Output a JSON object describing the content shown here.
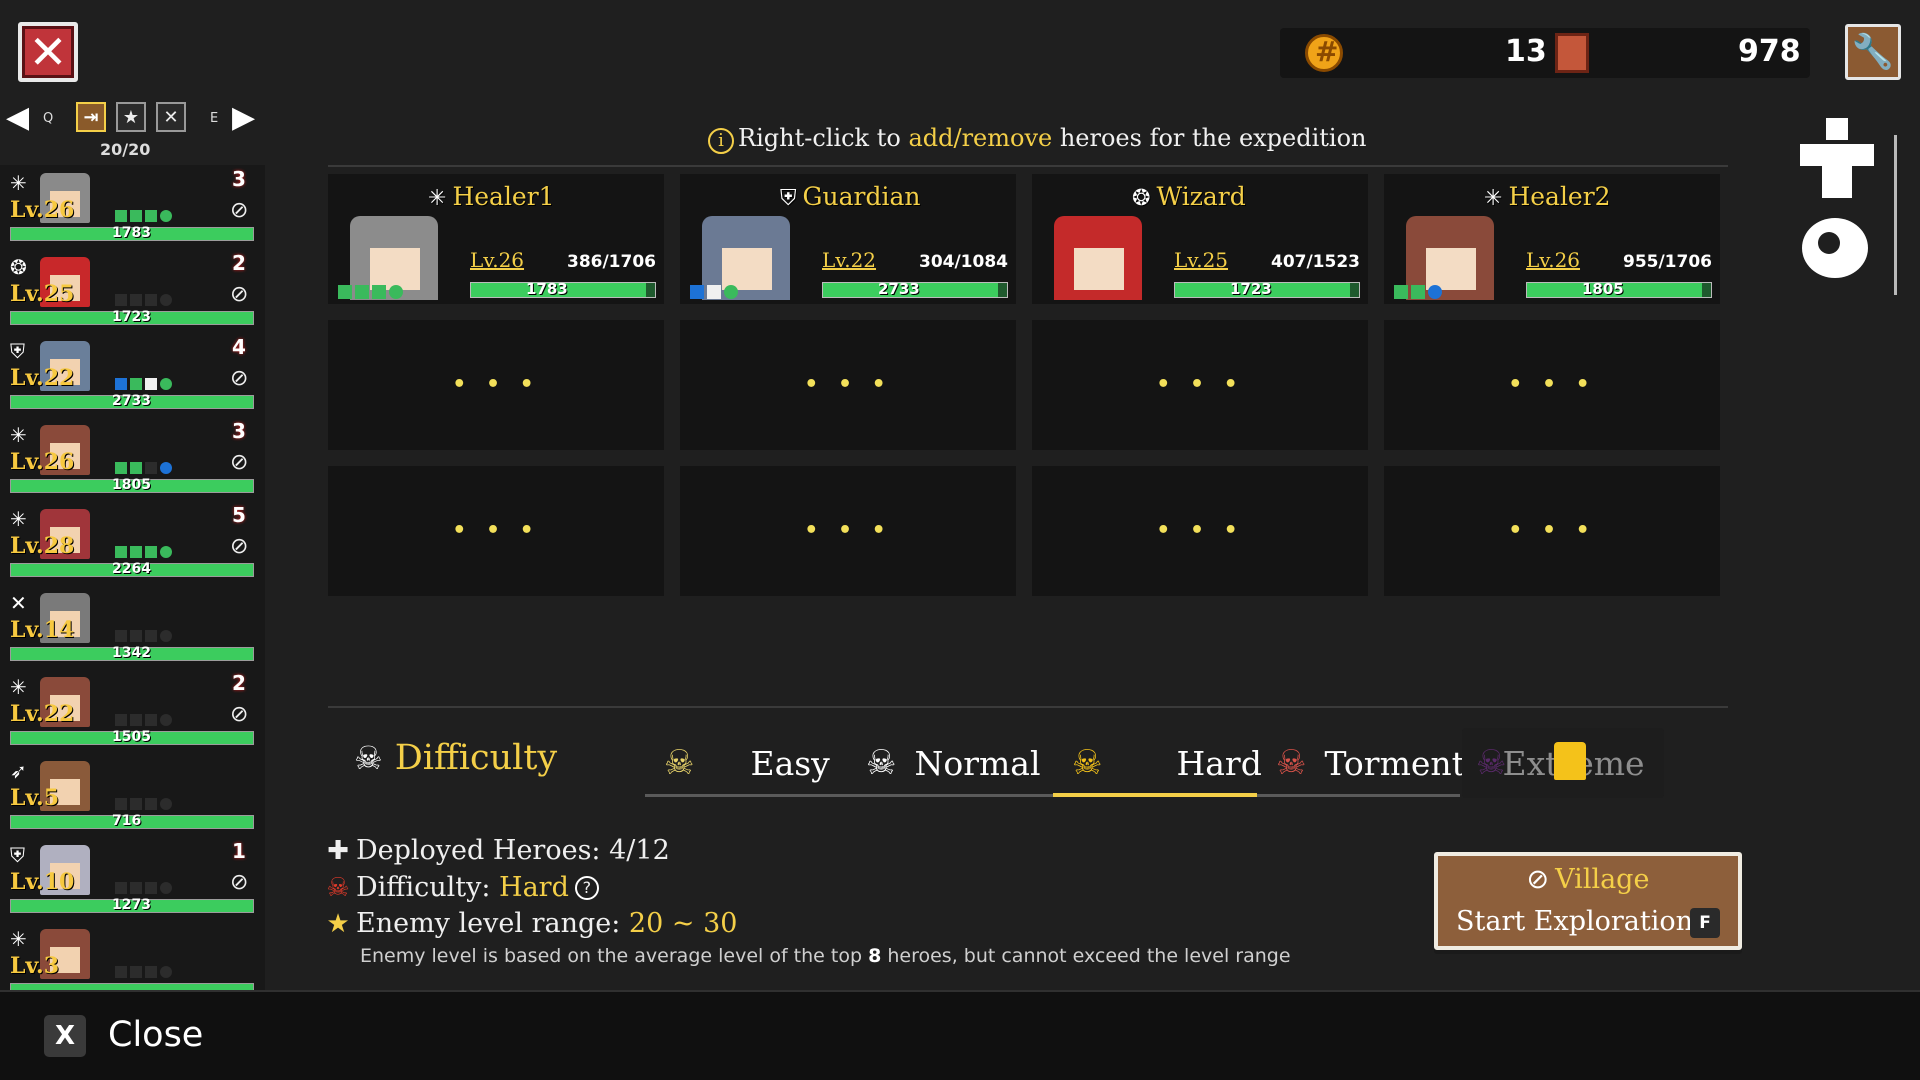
{
  "header": {
    "coins": "13",
    "books": "978"
  },
  "filter": {
    "prev_key": "Q",
    "next_key": "E",
    "roster_count": "20/20"
  },
  "roster": [
    {
      "class_icon": "healer-icon",
      "level": "Lv.26",
      "hp": "1783",
      "badge": "3",
      "pips": [
        "g",
        "g",
        "g",
        "round-g"
      ]
    },
    {
      "class_icon": "wizard-icon",
      "level": "Lv.25",
      "hp": "1723",
      "badge": "2",
      "pips": [
        "d",
        "d",
        "d",
        "round-d"
      ]
    },
    {
      "class_icon": "guardian-icon",
      "level": "Lv.22",
      "hp": "2733",
      "badge": "4",
      "pips": [
        "b",
        "g",
        "w",
        "round-g"
      ]
    },
    {
      "class_icon": "healer-icon",
      "level": "Lv.26",
      "hp": "1805",
      "badge": "3",
      "pips": [
        "g",
        "g",
        "d",
        "round-b"
      ]
    },
    {
      "class_icon": "healer-icon",
      "level": "Lv.28",
      "hp": "2264",
      "badge": "5",
      "pips": [
        "g",
        "g",
        "g",
        "round-g"
      ]
    },
    {
      "class_icon": "warrior-icon",
      "level": "Lv.14",
      "hp": "1342",
      "badge": "",
      "pips": [
        "d",
        "d",
        "d",
        "round-d"
      ]
    },
    {
      "class_icon": "healer-icon",
      "level": "Lv.22",
      "hp": "1505",
      "badge": "2",
      "pips": [
        "d",
        "d",
        "d",
        "round-d"
      ]
    },
    {
      "class_icon": "archer-icon",
      "level": "Lv.5",
      "hp": "716",
      "badge": "",
      "pips": [
        "d",
        "d",
        "d",
        "round-d"
      ]
    },
    {
      "class_icon": "guardian-icon",
      "level": "Lv.10",
      "hp": "1273",
      "badge": "1",
      "pips": [
        "d",
        "d",
        "d",
        "round-d"
      ]
    },
    {
      "class_icon": "healer-icon",
      "level": "Lv.3",
      "hp": "",
      "badge": "",
      "pips": [
        "d",
        "d",
        "d",
        "round-d"
      ]
    }
  ],
  "hint": {
    "prefix": "Right-click to ",
    "highlight": "add/remove",
    "suffix": " heroes for the expedition"
  },
  "party": [
    {
      "name": "Healer1",
      "level": "Lv.26",
      "hp": "386/1706",
      "max": "1783",
      "hp_fraction": 0.95
    },
    {
      "name": "Guardian",
      "level": "Lv.22",
      "hp": "304/1084",
      "max": "2733",
      "hp_fraction": 0.95
    },
    {
      "name": "Wizard",
      "level": "Lv.25",
      "hp": "407/1523",
      "max": "1723",
      "hp_fraction": 0.95
    },
    {
      "name": "Healer2",
      "level": "Lv.26",
      "hp": "955/1706",
      "max": "1805",
      "hp_fraction": 0.95
    }
  ],
  "empty_slot": "• • •",
  "difficulty": {
    "title": "Difficulty",
    "tabs": [
      "Easy",
      "Normal",
      "Hard",
      "Torment",
      "Extreme"
    ],
    "selected": "Hard"
  },
  "summary": {
    "deployed_label": "Deployed Heroes: ",
    "deployed_value": "4/12",
    "difficulty_label": "Difficulty: ",
    "difficulty_value": "Hard",
    "range_label": "Enemy level range: ",
    "range_value": "20 ~ 30",
    "note_prefix": "Enemy level is based on the average level of the top ",
    "note_num": "8",
    "note_suffix": " heroes, but cannot exceed the level range"
  },
  "start_button": {
    "destination": "Village",
    "label": "Start Exploration",
    "key": "F"
  },
  "bottom": {
    "key": "X",
    "label": "Close"
  }
}
